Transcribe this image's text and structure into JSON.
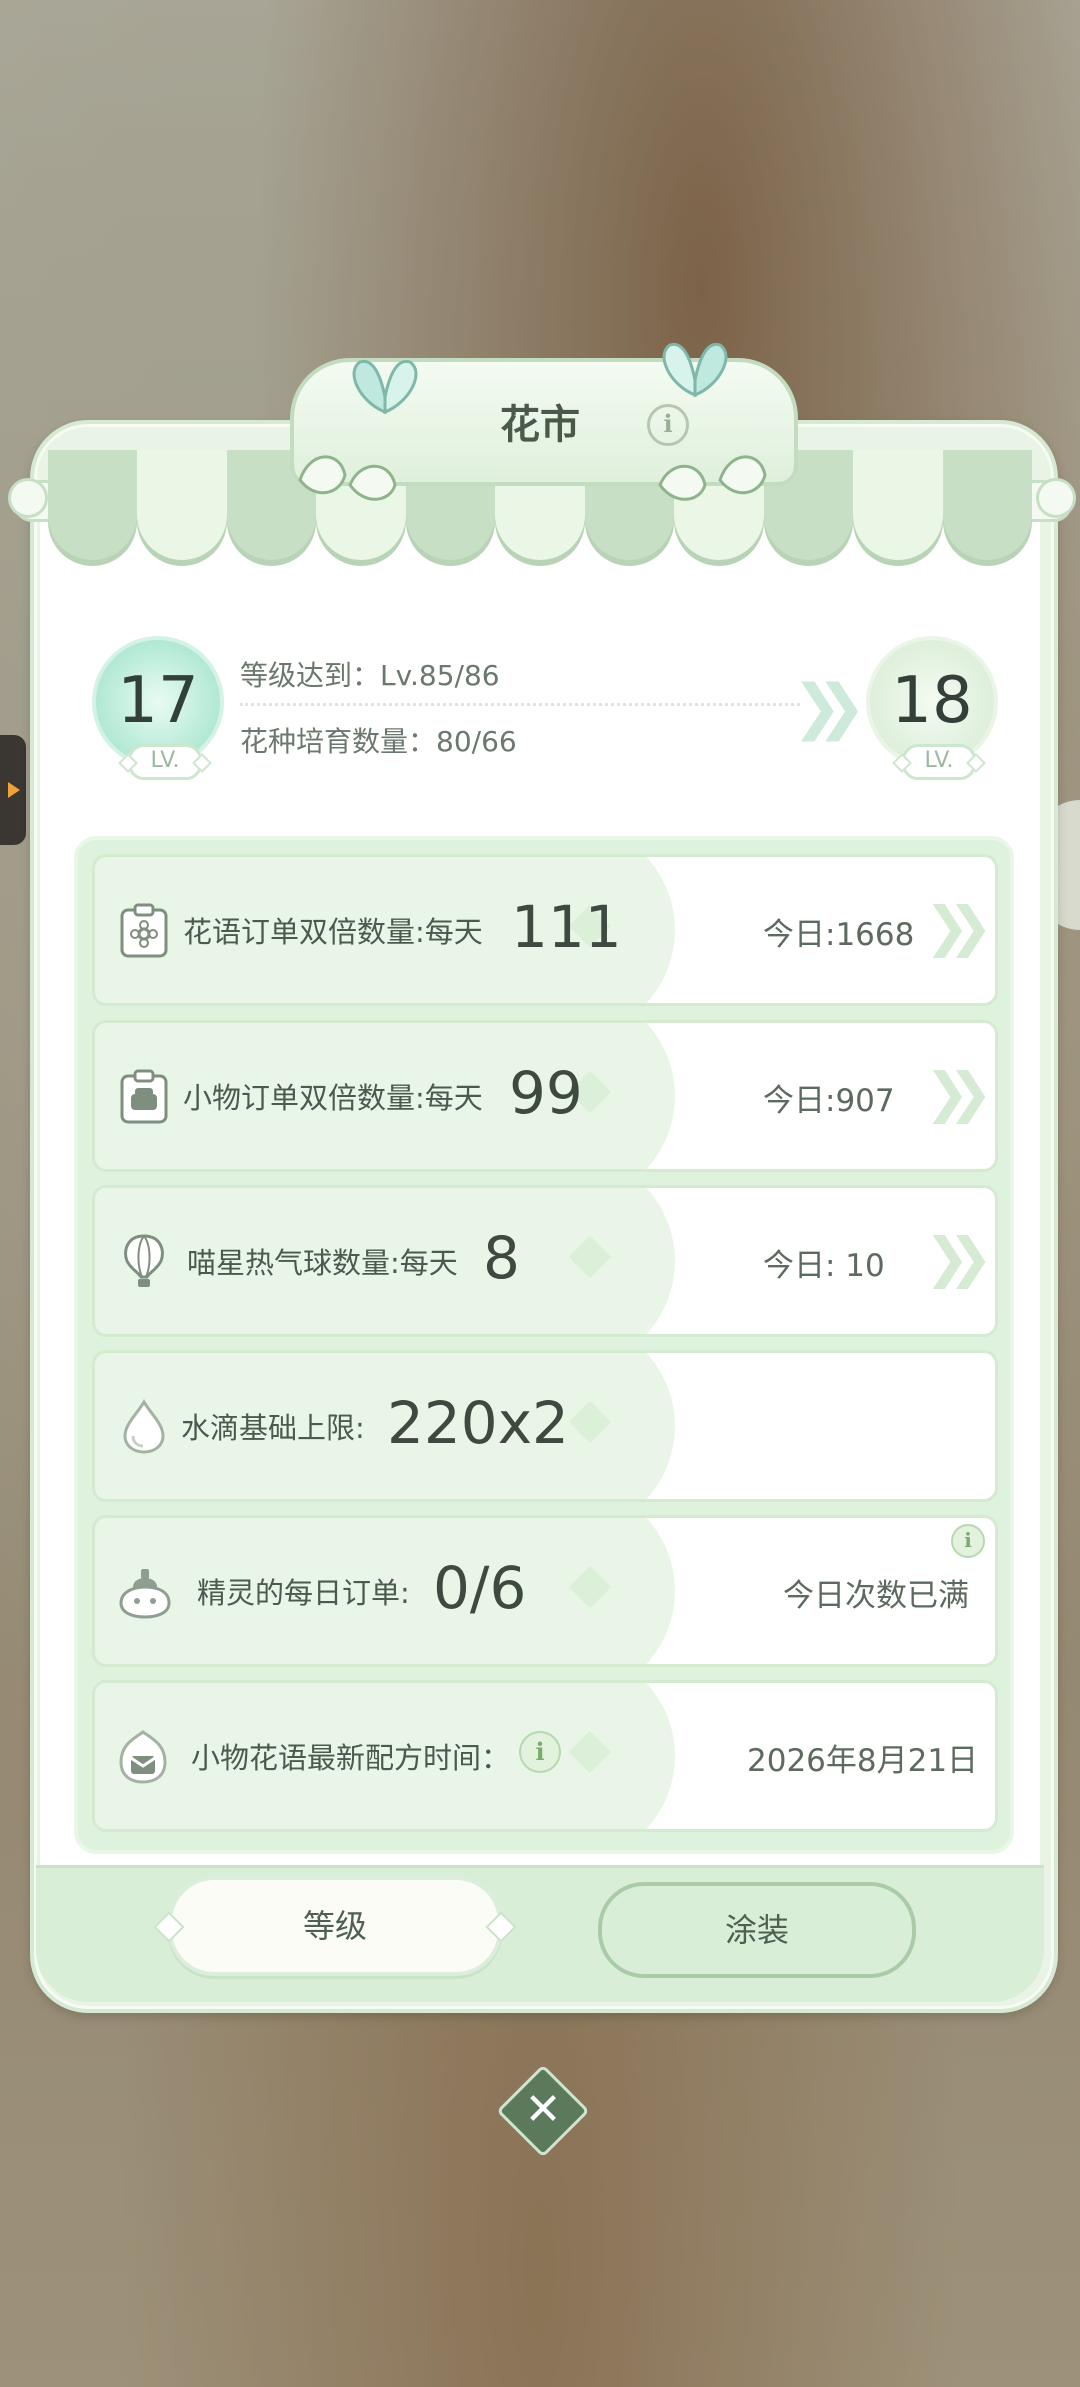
{
  "header": {
    "title": "花市",
    "info_icon": "info-icon"
  },
  "level": {
    "current": "17",
    "next": "18",
    "lv_tag": "LV.",
    "req_level": "等级达到：Lv.85/86",
    "req_seeds": "花种培育数量：80/66"
  },
  "rows": [
    {
      "label": "花语订单双倍数量:每天",
      "value": "111",
      "today": "今日:1668",
      "icon": "flower-order-icon"
    },
    {
      "label": "小物订单双倍数量:每天",
      "value": "99",
      "today": "今日:907",
      "icon": "item-order-icon"
    },
    {
      "label": "喵星热气球数量:每天",
      "value": "8",
      "today": "今日: 10",
      "icon": "balloon-icon"
    },
    {
      "label": "水滴基础上限:",
      "value": "220x2",
      "icon": "water-drop-icon"
    },
    {
      "label": "精灵的每日订单:",
      "value": "0/6",
      "today": "今日次数已满",
      "icon": "spirit-icon"
    },
    {
      "label": "小物花语最新配方时间：",
      "today": "2026年8月21日",
      "icon": "recipe-icon"
    }
  ],
  "footer": {
    "level_button": "等级",
    "skin_button": "涂装"
  },
  "colors": {
    "panel": "#e9f4e6",
    "accent": "#a9e6cf",
    "close": "#5b7a5b"
  }
}
